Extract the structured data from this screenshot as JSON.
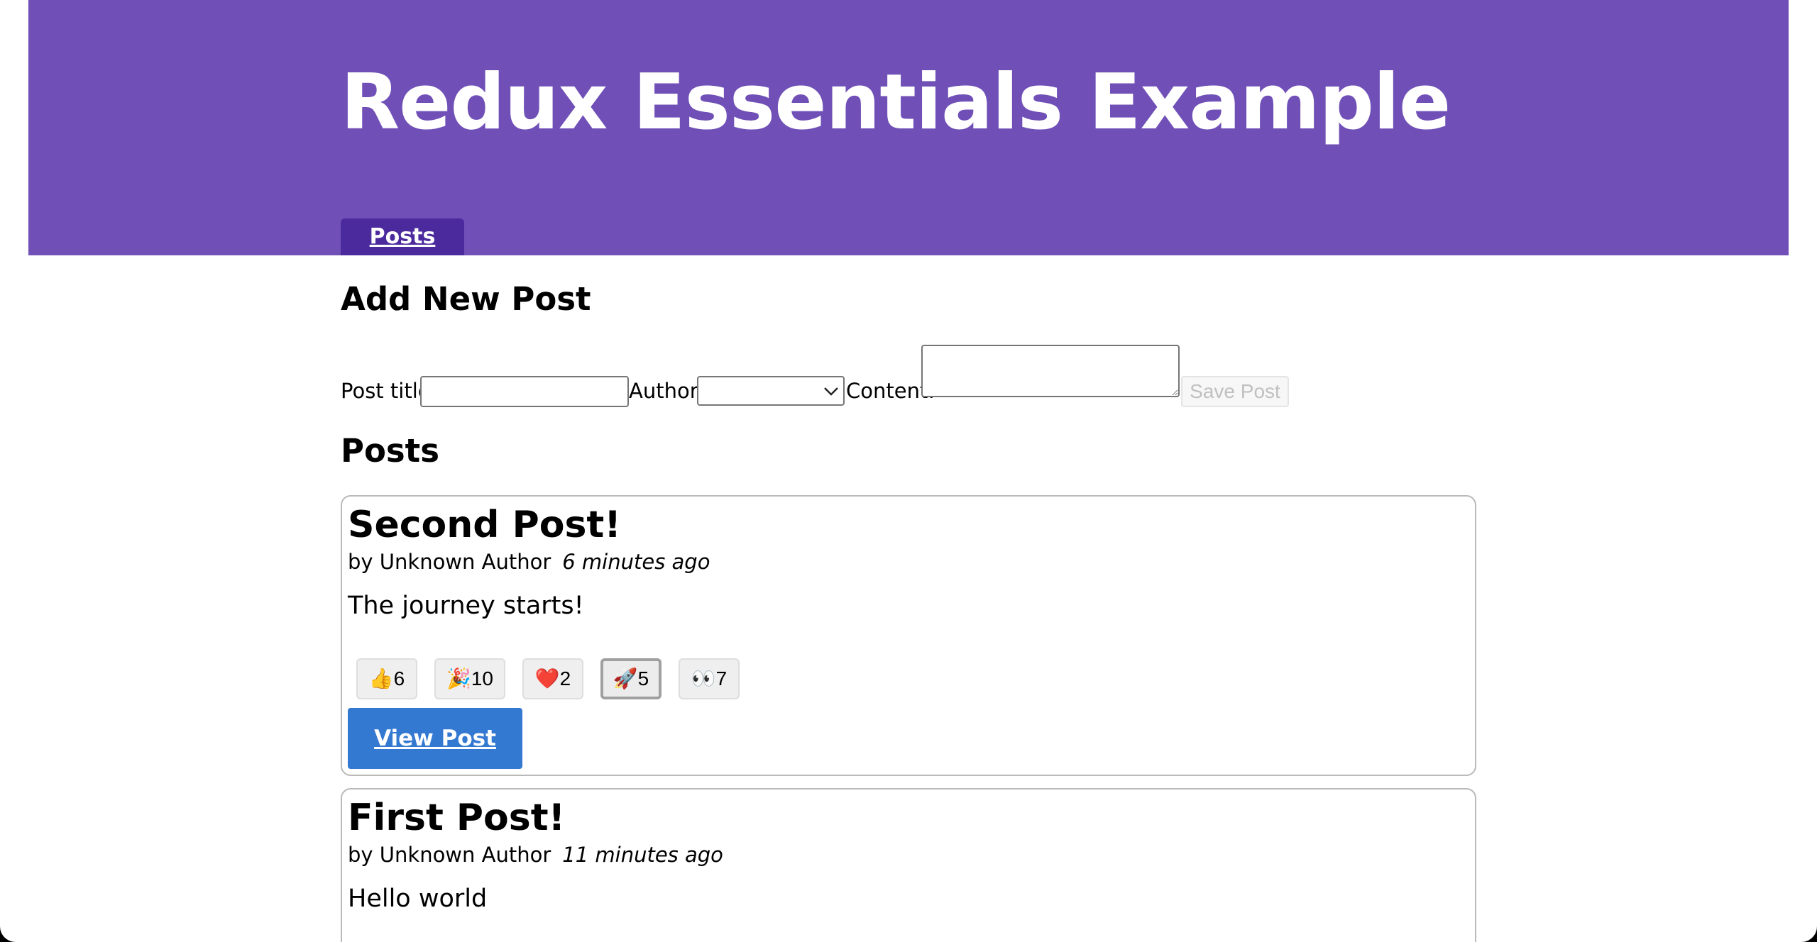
{
  "header": {
    "title": "Redux Essentials Example",
    "nav_posts": "Posts"
  },
  "add_post": {
    "heading": "Add New Post",
    "title_label": "Post title:",
    "title_value": "",
    "author_label": "Author:",
    "author_value": "",
    "content_label": "Content:",
    "content_value": "",
    "save_label": "Save Post"
  },
  "posts_section": {
    "heading": "Posts"
  },
  "posts": [
    {
      "title": "Second Post!",
      "author": "by Unknown Author",
      "time": "6 minutes ago",
      "body": "The journey starts!",
      "reactions": [
        {
          "emoji": "👍",
          "count": "6"
        },
        {
          "emoji": "🎉",
          "count": "10"
        },
        {
          "emoji": "❤️",
          "count": "2"
        },
        {
          "emoji": "🚀",
          "count": "5"
        },
        {
          "emoji": "👀",
          "count": "7"
        }
      ],
      "view_label": "View Post"
    },
    {
      "title": "First Post!",
      "author": "by Unknown Author",
      "time": "11 minutes ago",
      "body": "Hello world"
    }
  ],
  "colors": {
    "header_bg": "#7050b7",
    "nav_active_bg": "#4b2a9e",
    "view_button_bg": "#3378d1"
  }
}
